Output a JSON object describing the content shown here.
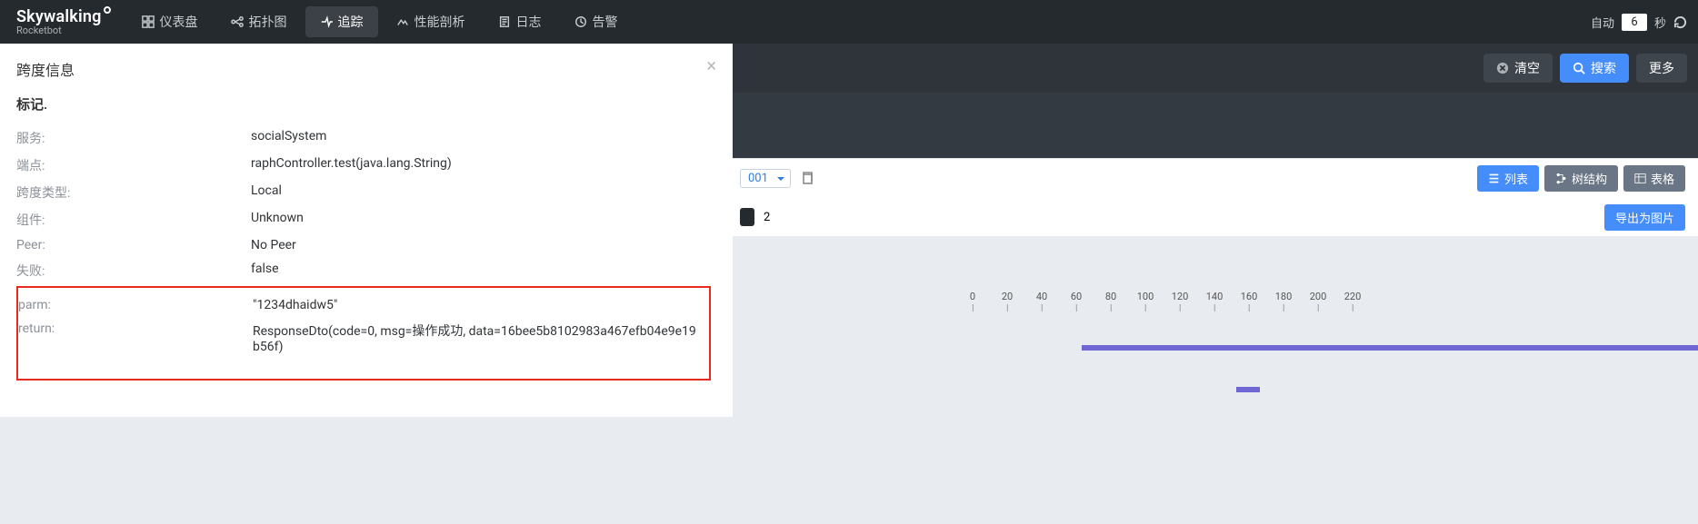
{
  "brand": {
    "name": "Skywalking",
    "sub": "Rocketbot"
  },
  "nav": {
    "items": [
      {
        "label": "仪表盘"
      },
      {
        "label": "拓扑图"
      },
      {
        "label": "追踪"
      },
      {
        "label": "性能剖析"
      },
      {
        "label": "日志"
      },
      {
        "label": "告警"
      }
    ]
  },
  "refresh": {
    "auto_label": "自动",
    "value": "6",
    "unit": "秒"
  },
  "subbar": {
    "clear": "清空",
    "search": "搜索",
    "more": "更多"
  },
  "light": {
    "select_value": "001",
    "count": "2",
    "list": "列表",
    "tree": "树结构",
    "table": "表格",
    "export": "导出为图片"
  },
  "ticks": [
    "0",
    "20",
    "40",
    "60",
    "80",
    "100",
    "120",
    "140",
    "160",
    "180",
    "200",
    "220"
  ],
  "modal": {
    "title": "跨度信息",
    "subtitle": "标记.",
    "rows": [
      {
        "k": "服务:",
        "v": "socialSystem"
      },
      {
        "k": "端点:",
        "v": "                                                raphController.test(java.lang.String)"
      },
      {
        "k": "跨度类型:",
        "v": "Local"
      },
      {
        "k": "组件:",
        "v": "Unknown"
      },
      {
        "k": "Peer:",
        "v": "No Peer"
      },
      {
        "k": "失败:",
        "v": "false"
      }
    ],
    "red": [
      {
        "k": "parm:",
        "v": "\"1234dhaidw5\""
      },
      {
        "k": "return:",
        "v": "ResponseDto(code=0, msg=操作成功, data=16bee5b8102983a467efb04e9e19b56f)"
      }
    ]
  }
}
